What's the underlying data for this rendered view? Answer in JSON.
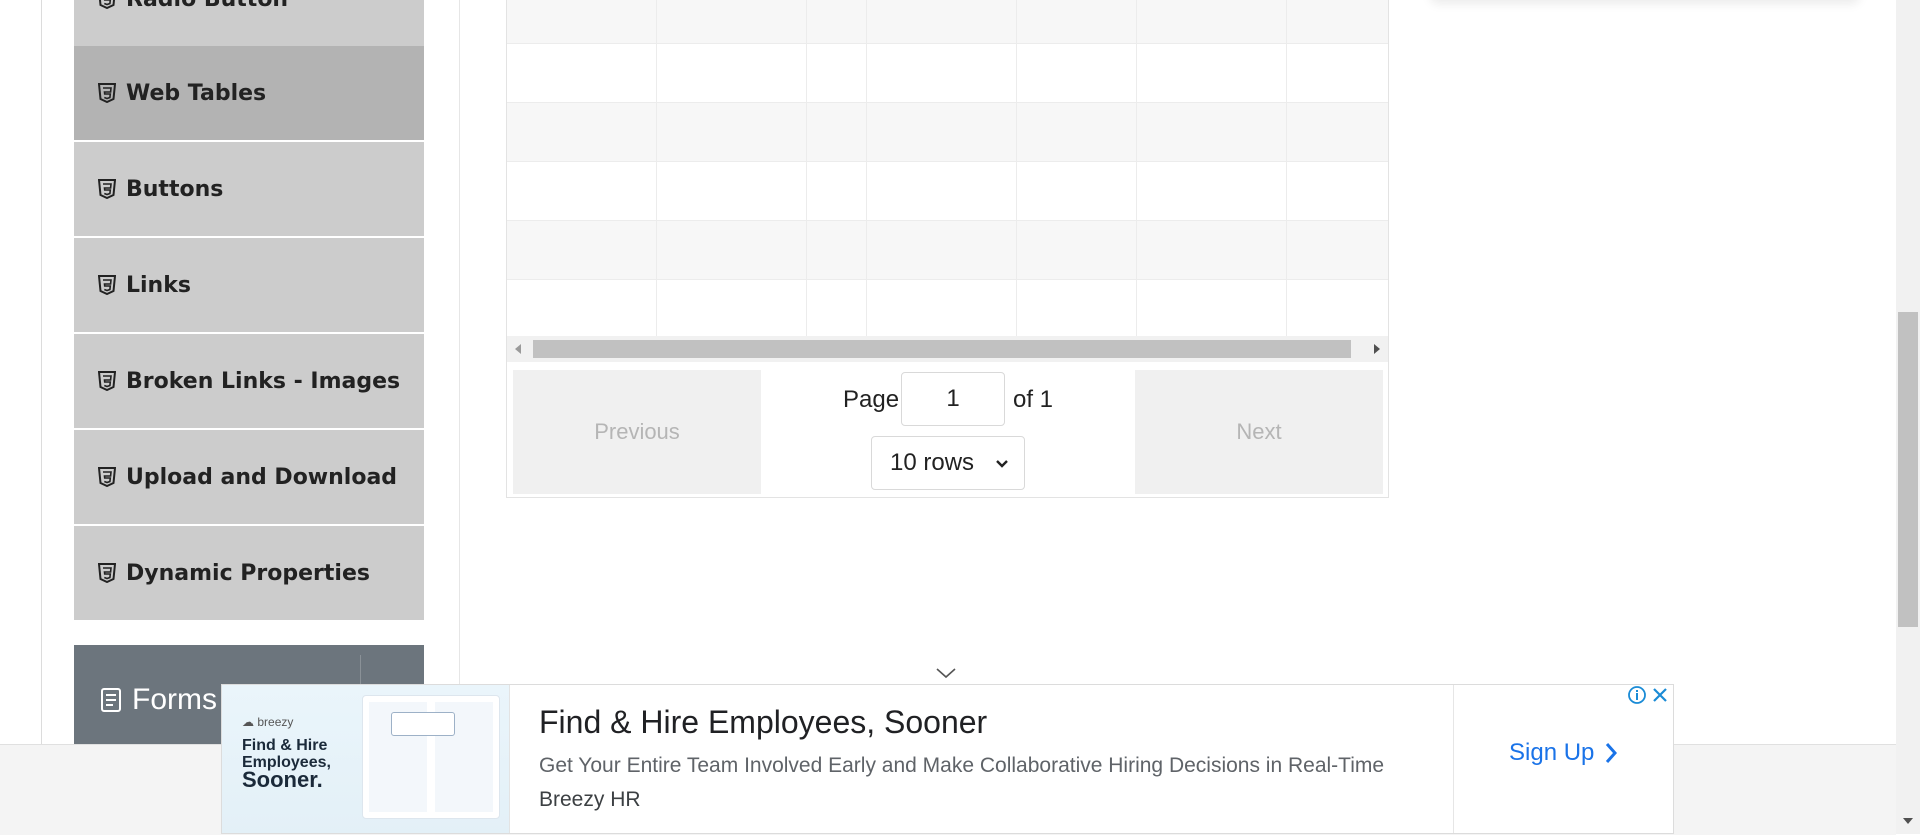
{
  "sidebar": {
    "items": [
      {
        "label": "Radio Button"
      },
      {
        "label": "Web Tables"
      },
      {
        "label": "Buttons"
      },
      {
        "label": "Links"
      },
      {
        "label": "Broken Links - Images"
      },
      {
        "label": "Upload and Download"
      },
      {
        "label": "Dynamic Properties"
      }
    ],
    "forms_label": "Forms"
  },
  "pagination": {
    "previous_label": "Previous",
    "next_label": "Next",
    "page_label": "Page",
    "page_value": "1",
    "of_label": "of 1",
    "rows_selected": "10 rows"
  },
  "ad": {
    "brand": "breezy",
    "tagline_line1": "Find & Hire",
    "tagline_line2": "Employees,",
    "tagline_line3": "Sooner.",
    "title": "Find & Hire Employees, Sooner",
    "description": "Get Your Entire Team Involved Early and Make Collaborative Hiring Decisions in Real-Time",
    "source": "Breezy HR",
    "cta": "Sign Up"
  },
  "colors": {
    "menu_bg": "#cccccc",
    "menu_active_bg": "#b3b3b3",
    "forms_header_bg": "#6c757d",
    "ad_link": "#1a73e8"
  }
}
